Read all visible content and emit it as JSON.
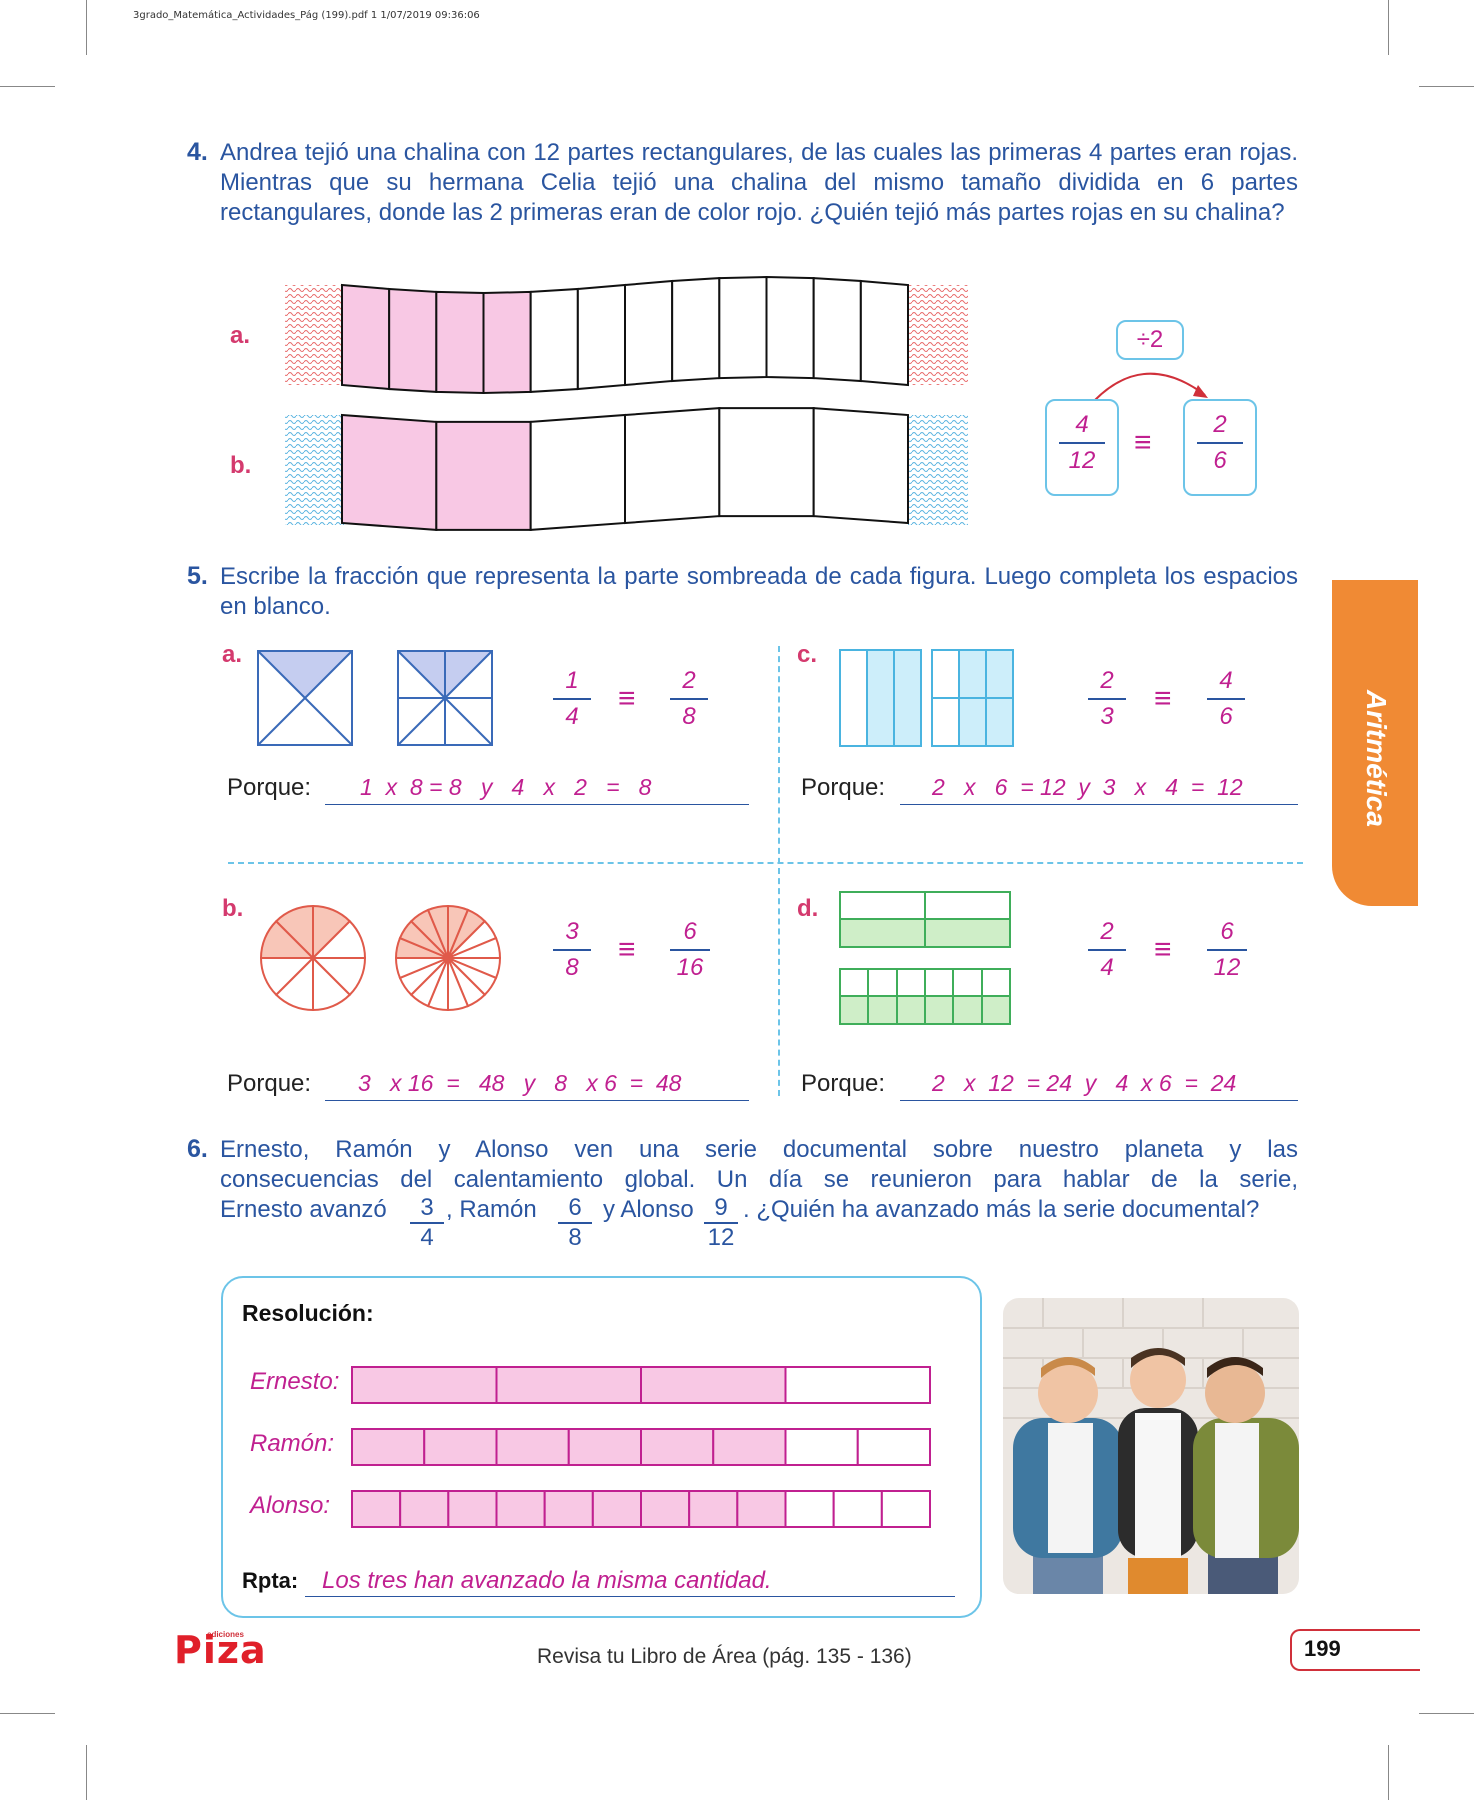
{
  "header": {
    "meta": "3grado_Matemática_Actividades_Pág (199).pdf   1   1/07/2019   09:36:06"
  },
  "q4": {
    "number": "4.",
    "text": "Andrea tejió una chalina con 12 partes rectangulares, de las cuales las primeras 4 partes eran rojas. Mientras que su hermana Celia tejió una chalina del mismo tamaño dividida en 6 partes rectangulares, donde las 2 primeras eran de color rojo. ¿Quién tejió más partes rojas en su chalina?",
    "label_a": "a.",
    "label_b": "b.",
    "scarf_a": {
      "parts": 12,
      "shaded": 4
    },
    "scarf_b": {
      "parts": 6,
      "shaded": 2
    },
    "operator": "÷2",
    "left_fraction": {
      "num": "4",
      "den": "12"
    },
    "right_fraction": {
      "num": "2",
      "den": "6"
    },
    "equiv_sign": "≡"
  },
  "q5": {
    "number": "5.",
    "text": "Escribe la fracción que representa la parte sombreada de cada figura. Luego completa los espacios en blanco.",
    "porque_label": "Porque:",
    "items": {
      "a": {
        "label": "a.",
        "f1": {
          "num": "1",
          "den": "4"
        },
        "f2": {
          "num": "2",
          "den": "8"
        },
        "answer": "1  x  8 = 8   y   4   x   2   =   8"
      },
      "b": {
        "label": "b.",
        "f1": {
          "num": "3",
          "den": "8"
        },
        "f2": {
          "num": "6",
          "den": "16"
        },
        "answer": "3   x 16  =   48   y   8   x 6  =  48"
      },
      "c": {
        "label": "c.",
        "f1": {
          "num": "2",
          "den": "3"
        },
        "f2": {
          "num": "4",
          "den": "6"
        },
        "answer": "2   x   6  = 12  y  3   x   4  =  12"
      },
      "d": {
        "label": "d.",
        "f1": {
          "num": "2",
          "den": "4"
        },
        "f2": {
          "num": "6",
          "den": "12"
        },
        "answer": "2   x  12  = 24  y   4  x 6  =  24"
      }
    }
  },
  "q6": {
    "number": "6.",
    "line1": "Ernesto, Ramón y Alonso ven una serie documental sobre nuestro planeta y las",
    "line2": "consecuencias del calentamiento global. Un día se reunieron para hablar de la serie,",
    "line3_a": "Ernesto avanzó",
    "line3_b": ", Ramón",
    "line3_c": "y Alonso",
    "line3_d": ". ¿Quién ha avanzado más la serie documental?",
    "f_ernesto": {
      "num": "3",
      "den": "4"
    },
    "f_ramon": {
      "num": "6",
      "den": "8"
    },
    "f_alonso": {
      "num": "9",
      "den": "12"
    },
    "resolucion_title": "Resolución:",
    "bars": [
      {
        "name": "Ernesto:",
        "parts": 4,
        "shaded": 3
      },
      {
        "name": "Ramón:",
        "parts": 8,
        "shaded": 6
      },
      {
        "name": "Alonso:",
        "parts": 12,
        "shaded": 9
      }
    ],
    "rpta_label": "Rpta:",
    "rpta_answer": "Los tres han avanzado la misma cantidad."
  },
  "side_tab": "Aritmética",
  "footer": {
    "logo_small": "ediciones",
    "logo": "Piza",
    "review": "Revisa tu Libro de Área (pág. 135 - 136)",
    "page": "199"
  },
  "colors": {
    "blue_text": "#2a55a0",
    "magenta": "#c02090",
    "pink_fill": "#f8c8e4",
    "orange_tab": "#f08a34"
  }
}
